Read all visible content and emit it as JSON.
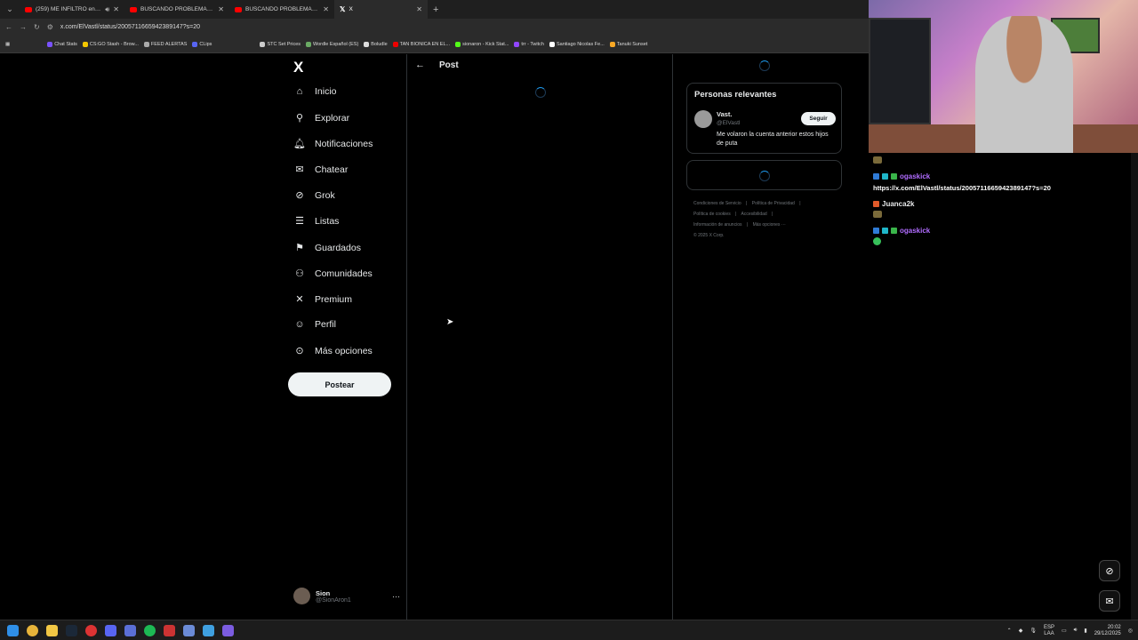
{
  "browser": {
    "tabs": [
      {
        "label": "(259) ME INFILTRO en un S...",
        "type": "youtube",
        "active": false
      },
      {
        "label": "BUSCANDO PROBLEMAS EN FI...",
        "type": "youtube",
        "active": false
      },
      {
        "label": "BUSCANDO PROBLEMAS EN B...",
        "type": "youtube",
        "active": false
      },
      {
        "label": "X",
        "type": "x",
        "active": true
      }
    ],
    "url": "x.com/ElVastl/status/2005711665942389147?s=20",
    "bookmarks": [
      "Chat Stats",
      "CS:GO Stash - Brow...",
      "FEED ALERTAS",
      "CLips",
      "STC Set Prices",
      "Wordle Español (ES)",
      "Boludle",
      "TAN BIONICA EN EL...",
      "sionaron - Kick Stat...",
      "trr - Twitch",
      "Santiago Nicolas Fe...",
      "Tanuki Sunset"
    ]
  },
  "x": {
    "logo": "X",
    "nav": [
      {
        "label": "Inicio",
        "icon": "home-icon",
        "glyph": "⌂"
      },
      {
        "label": "Explorar",
        "icon": "search-icon",
        "glyph": "⚲"
      },
      {
        "label": "Notificaciones",
        "icon": "bell-icon",
        "glyph": "🔔︎"
      },
      {
        "label": "Chatear",
        "icon": "mail-icon",
        "glyph": "✉"
      },
      {
        "label": "Grok",
        "icon": "grok-icon",
        "glyph": "⊘"
      },
      {
        "label": "Listas",
        "icon": "list-icon",
        "glyph": "☰"
      },
      {
        "label": "Guardados",
        "icon": "bookmark-icon",
        "glyph": "⚑"
      },
      {
        "label": "Comunidades",
        "icon": "communities-icon",
        "glyph": "⚇"
      },
      {
        "label": "Premium",
        "icon": "x-premium-icon",
        "glyph": "✕"
      },
      {
        "label": "Perfil",
        "icon": "profile-icon",
        "glyph": "☺"
      },
      {
        "label": "Más opciones",
        "icon": "more-options-icon",
        "glyph": "⊙"
      }
    ],
    "post_button": "Postear",
    "account": {
      "name": "Sion",
      "handle": "@SionAron1",
      "more": "···"
    },
    "main": {
      "back": "←",
      "title": "Post"
    },
    "relevant": {
      "title": "Personas relevantes",
      "name": "Vast.",
      "handle": "@ElVastl",
      "follow": "Seguir",
      "bio": "Me volaron la cuenta anterior estos hijos de puta"
    },
    "footer": {
      "links": [
        "Condiciones de Servicio",
        "|",
        "Política de Privacidad",
        "|",
        "Política de cookies",
        "|",
        "Accesibilidad",
        "|",
        "Información de anuncios",
        "|",
        "Más opciones ···"
      ],
      "copyright": "© 2025 X Corp."
    }
  },
  "chat": {
    "messages": [
      {
        "user": "ogaskick",
        "text": "https://x.com/ElVastl/status/2005711665942389147?s=20"
      },
      {
        "user": "Juanca2k",
        "text": ""
      },
      {
        "user": "ogaskick",
        "text": ""
      }
    ]
  },
  "taskbar": {
    "language": "ESP",
    "layout": "LAA",
    "time": "20:02",
    "date": "29/12/2025"
  },
  "colors": {
    "accent": "#1d9bf0",
    "chat_user": "#b06cff"
  }
}
